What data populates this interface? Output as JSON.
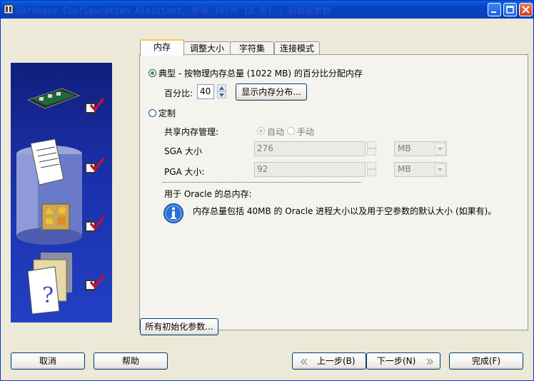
{
  "window": {
    "title": "Database Configuration Assistant, 步骤 10(共 12 步) : 初始化参数"
  },
  "tabs": [
    {
      "label": "内存",
      "active": true
    },
    {
      "label": "调整大小",
      "active": false
    },
    {
      "label": "字符集",
      "active": false
    },
    {
      "label": "连接模式",
      "active": false
    }
  ],
  "memory": {
    "typical_label": "典型 - 按物理内存总量 (1022 MB) 的百分比分配内存",
    "percent_label": "百分比:",
    "percent_value": "40",
    "show_distribution_button": "显示内存分布...",
    "custom_label": "定制",
    "shared_memory_label": "共享内存管理:",
    "auto_label": "自动",
    "manual_label": "手动",
    "sga_label": "SGA 大小",
    "sga_value": "276",
    "sga_unit": "MB",
    "pga_label": "PGA 大小:",
    "pga_value": "92",
    "pga_unit": "MB",
    "total_label": "用于 Oracle 的总内存:",
    "info_text": "内存总量包括 40MB 的 Oracle 进程大小以及用于空参数的默认大小 (如果有)。"
  },
  "buttons": {
    "all_params": "所有初始化参数...",
    "cancel": "取消",
    "help": "帮助",
    "back": "上一步(B)",
    "next": "下一步(N)",
    "finish": "完成(F)"
  },
  "colors": {
    "accent": "#0a5fd8",
    "art_background": "#1a2fa8",
    "check_red": "#c8102e",
    "radio_green": "#21a121"
  }
}
